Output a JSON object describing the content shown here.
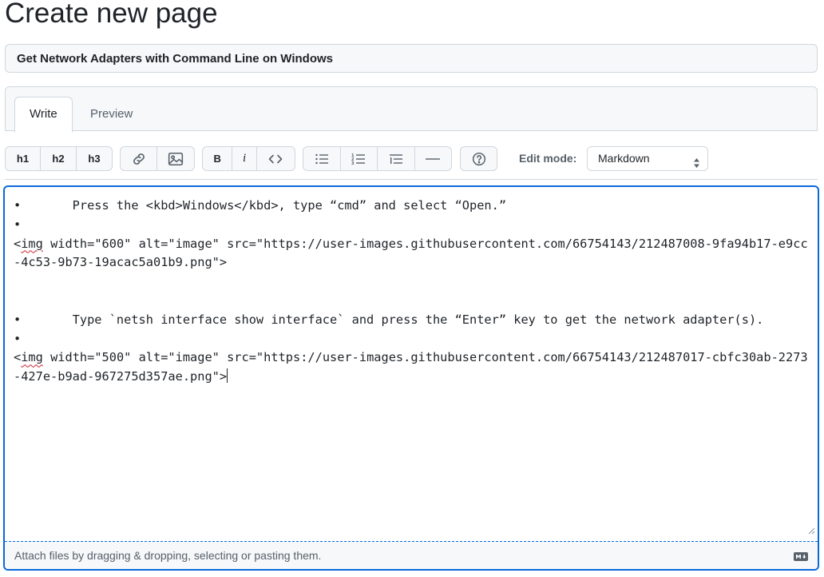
{
  "page_title": "Create new page",
  "title_input": {
    "value": "Get Network Adapters with Command Line on Windows"
  },
  "tabs": [
    {
      "label": "Write",
      "active": true
    },
    {
      "label": "Preview",
      "active": false
    }
  ],
  "toolbar": {
    "headings": [
      "h1",
      "h2",
      "h3"
    ],
    "link_icon": "link-icon",
    "image_icon": "image-icon",
    "bold": "B",
    "italic": "i",
    "code_icon": "code-icon",
    "unordered_list_icon": "unordered-list-icon",
    "ordered_list_icon": "ordered-list-icon",
    "task_list_icon": "task-list-icon",
    "horizontal_rule_icon": "horizontal-rule-icon",
    "help_icon": "question-icon",
    "edit_mode_label": "Edit mode:",
    "edit_mode_value": "Markdown"
  },
  "editor": {
    "lines": [
      {
        "pre": "•       Press the <kbd>Windows</kbd>, type “cmd” and select “Open.”",
        "img": null,
        "post": ""
      },
      {
        "pre": "•",
        "img": null,
        "post": ""
      },
      {
        "pre": "<",
        "img": "img",
        "post": " width=\"600\" alt=\"image\" src=\"https://user-images.githubusercontent.com/66754143/212487008-9fa94b17-e9cc-4c53-9b73-19acac5a01b9.png\">"
      },
      {
        "pre": "",
        "img": null,
        "post": ""
      },
      {
        "pre": "",
        "img": null,
        "post": ""
      },
      {
        "pre": "•       Type `netsh interface show interface` and press the “Enter” key to get the network adapter(s).",
        "img": null,
        "post": ""
      },
      {
        "pre": "•",
        "img": null,
        "post": ""
      },
      {
        "pre": "<",
        "img": "img",
        "post": " width=\"500\" alt=\"image\" src=\"https://user-images.githubusercontent.com/66754143/212487017-cbfc30ab-2273-427e-b9ad-967275d357ae.png\">"
      }
    ],
    "attach_hint": "Attach files by dragging & dropping, selecting or pasting them.",
    "markdown_icon": "markdown-icon"
  },
  "colors": {
    "accent": "#0969da",
    "border": "#d0d7de",
    "muted": "#57606a",
    "bg_subtle": "#f6f8fa"
  }
}
